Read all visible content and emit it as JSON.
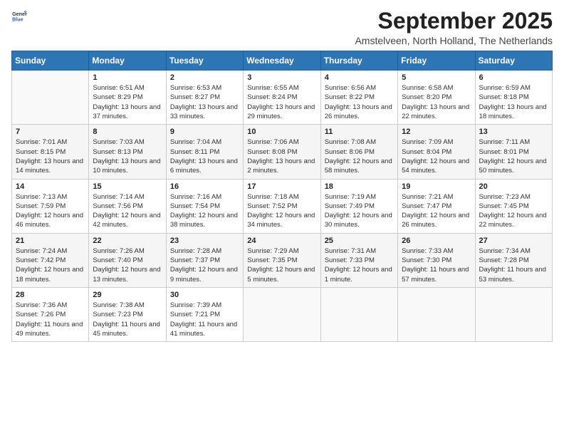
{
  "logo": {
    "text_general": "General",
    "text_blue": "Blue"
  },
  "header": {
    "month": "September 2025",
    "location": "Amstelveen, North Holland, The Netherlands"
  },
  "weekdays": [
    "Sunday",
    "Monday",
    "Tuesday",
    "Wednesday",
    "Thursday",
    "Friday",
    "Saturday"
  ],
  "weeks": [
    [
      {
        "day": "",
        "sunrise": "",
        "sunset": "",
        "daylight": ""
      },
      {
        "day": "1",
        "sunrise": "Sunrise: 6:51 AM",
        "sunset": "Sunset: 8:29 PM",
        "daylight": "Daylight: 13 hours and 37 minutes."
      },
      {
        "day": "2",
        "sunrise": "Sunrise: 6:53 AM",
        "sunset": "Sunset: 8:27 PM",
        "daylight": "Daylight: 13 hours and 33 minutes."
      },
      {
        "day": "3",
        "sunrise": "Sunrise: 6:55 AM",
        "sunset": "Sunset: 8:24 PM",
        "daylight": "Daylight: 13 hours and 29 minutes."
      },
      {
        "day": "4",
        "sunrise": "Sunrise: 6:56 AM",
        "sunset": "Sunset: 8:22 PM",
        "daylight": "Daylight: 13 hours and 26 minutes."
      },
      {
        "day": "5",
        "sunrise": "Sunrise: 6:58 AM",
        "sunset": "Sunset: 8:20 PM",
        "daylight": "Daylight: 13 hours and 22 minutes."
      },
      {
        "day": "6",
        "sunrise": "Sunrise: 6:59 AM",
        "sunset": "Sunset: 8:18 PM",
        "daylight": "Daylight: 13 hours and 18 minutes."
      }
    ],
    [
      {
        "day": "7",
        "sunrise": "Sunrise: 7:01 AM",
        "sunset": "Sunset: 8:15 PM",
        "daylight": "Daylight: 13 hours and 14 minutes."
      },
      {
        "day": "8",
        "sunrise": "Sunrise: 7:03 AM",
        "sunset": "Sunset: 8:13 PM",
        "daylight": "Daylight: 13 hours and 10 minutes."
      },
      {
        "day": "9",
        "sunrise": "Sunrise: 7:04 AM",
        "sunset": "Sunset: 8:11 PM",
        "daylight": "Daylight: 13 hours and 6 minutes."
      },
      {
        "day": "10",
        "sunrise": "Sunrise: 7:06 AM",
        "sunset": "Sunset: 8:08 PM",
        "daylight": "Daylight: 13 hours and 2 minutes."
      },
      {
        "day": "11",
        "sunrise": "Sunrise: 7:08 AM",
        "sunset": "Sunset: 8:06 PM",
        "daylight": "Daylight: 12 hours and 58 minutes."
      },
      {
        "day": "12",
        "sunrise": "Sunrise: 7:09 AM",
        "sunset": "Sunset: 8:04 PM",
        "daylight": "Daylight: 12 hours and 54 minutes."
      },
      {
        "day": "13",
        "sunrise": "Sunrise: 7:11 AM",
        "sunset": "Sunset: 8:01 PM",
        "daylight": "Daylight: 12 hours and 50 minutes."
      }
    ],
    [
      {
        "day": "14",
        "sunrise": "Sunrise: 7:13 AM",
        "sunset": "Sunset: 7:59 PM",
        "daylight": "Daylight: 12 hours and 46 minutes."
      },
      {
        "day": "15",
        "sunrise": "Sunrise: 7:14 AM",
        "sunset": "Sunset: 7:56 PM",
        "daylight": "Daylight: 12 hours and 42 minutes."
      },
      {
        "day": "16",
        "sunrise": "Sunrise: 7:16 AM",
        "sunset": "Sunset: 7:54 PM",
        "daylight": "Daylight: 12 hours and 38 minutes."
      },
      {
        "day": "17",
        "sunrise": "Sunrise: 7:18 AM",
        "sunset": "Sunset: 7:52 PM",
        "daylight": "Daylight: 12 hours and 34 minutes."
      },
      {
        "day": "18",
        "sunrise": "Sunrise: 7:19 AM",
        "sunset": "Sunset: 7:49 PM",
        "daylight": "Daylight: 12 hours and 30 minutes."
      },
      {
        "day": "19",
        "sunrise": "Sunrise: 7:21 AM",
        "sunset": "Sunset: 7:47 PM",
        "daylight": "Daylight: 12 hours and 26 minutes."
      },
      {
        "day": "20",
        "sunrise": "Sunrise: 7:23 AM",
        "sunset": "Sunset: 7:45 PM",
        "daylight": "Daylight: 12 hours and 22 minutes."
      }
    ],
    [
      {
        "day": "21",
        "sunrise": "Sunrise: 7:24 AM",
        "sunset": "Sunset: 7:42 PM",
        "daylight": "Daylight: 12 hours and 18 minutes."
      },
      {
        "day": "22",
        "sunrise": "Sunrise: 7:26 AM",
        "sunset": "Sunset: 7:40 PM",
        "daylight": "Daylight: 12 hours and 13 minutes."
      },
      {
        "day": "23",
        "sunrise": "Sunrise: 7:28 AM",
        "sunset": "Sunset: 7:37 PM",
        "daylight": "Daylight: 12 hours and 9 minutes."
      },
      {
        "day": "24",
        "sunrise": "Sunrise: 7:29 AM",
        "sunset": "Sunset: 7:35 PM",
        "daylight": "Daylight: 12 hours and 5 minutes."
      },
      {
        "day": "25",
        "sunrise": "Sunrise: 7:31 AM",
        "sunset": "Sunset: 7:33 PM",
        "daylight": "Daylight: 12 hours and 1 minute."
      },
      {
        "day": "26",
        "sunrise": "Sunrise: 7:33 AM",
        "sunset": "Sunset: 7:30 PM",
        "daylight": "Daylight: 11 hours and 57 minutes."
      },
      {
        "day": "27",
        "sunrise": "Sunrise: 7:34 AM",
        "sunset": "Sunset: 7:28 PM",
        "daylight": "Daylight: 11 hours and 53 minutes."
      }
    ],
    [
      {
        "day": "28",
        "sunrise": "Sunrise: 7:36 AM",
        "sunset": "Sunset: 7:26 PM",
        "daylight": "Daylight: 11 hours and 49 minutes."
      },
      {
        "day": "29",
        "sunrise": "Sunrise: 7:38 AM",
        "sunset": "Sunset: 7:23 PM",
        "daylight": "Daylight: 11 hours and 45 minutes."
      },
      {
        "day": "30",
        "sunrise": "Sunrise: 7:39 AM",
        "sunset": "Sunset: 7:21 PM",
        "daylight": "Daylight: 11 hours and 41 minutes."
      },
      {
        "day": "",
        "sunrise": "",
        "sunset": "",
        "daylight": ""
      },
      {
        "day": "",
        "sunrise": "",
        "sunset": "",
        "daylight": ""
      },
      {
        "day": "",
        "sunrise": "",
        "sunset": "",
        "daylight": ""
      },
      {
        "day": "",
        "sunrise": "",
        "sunset": "",
        "daylight": ""
      }
    ]
  ]
}
